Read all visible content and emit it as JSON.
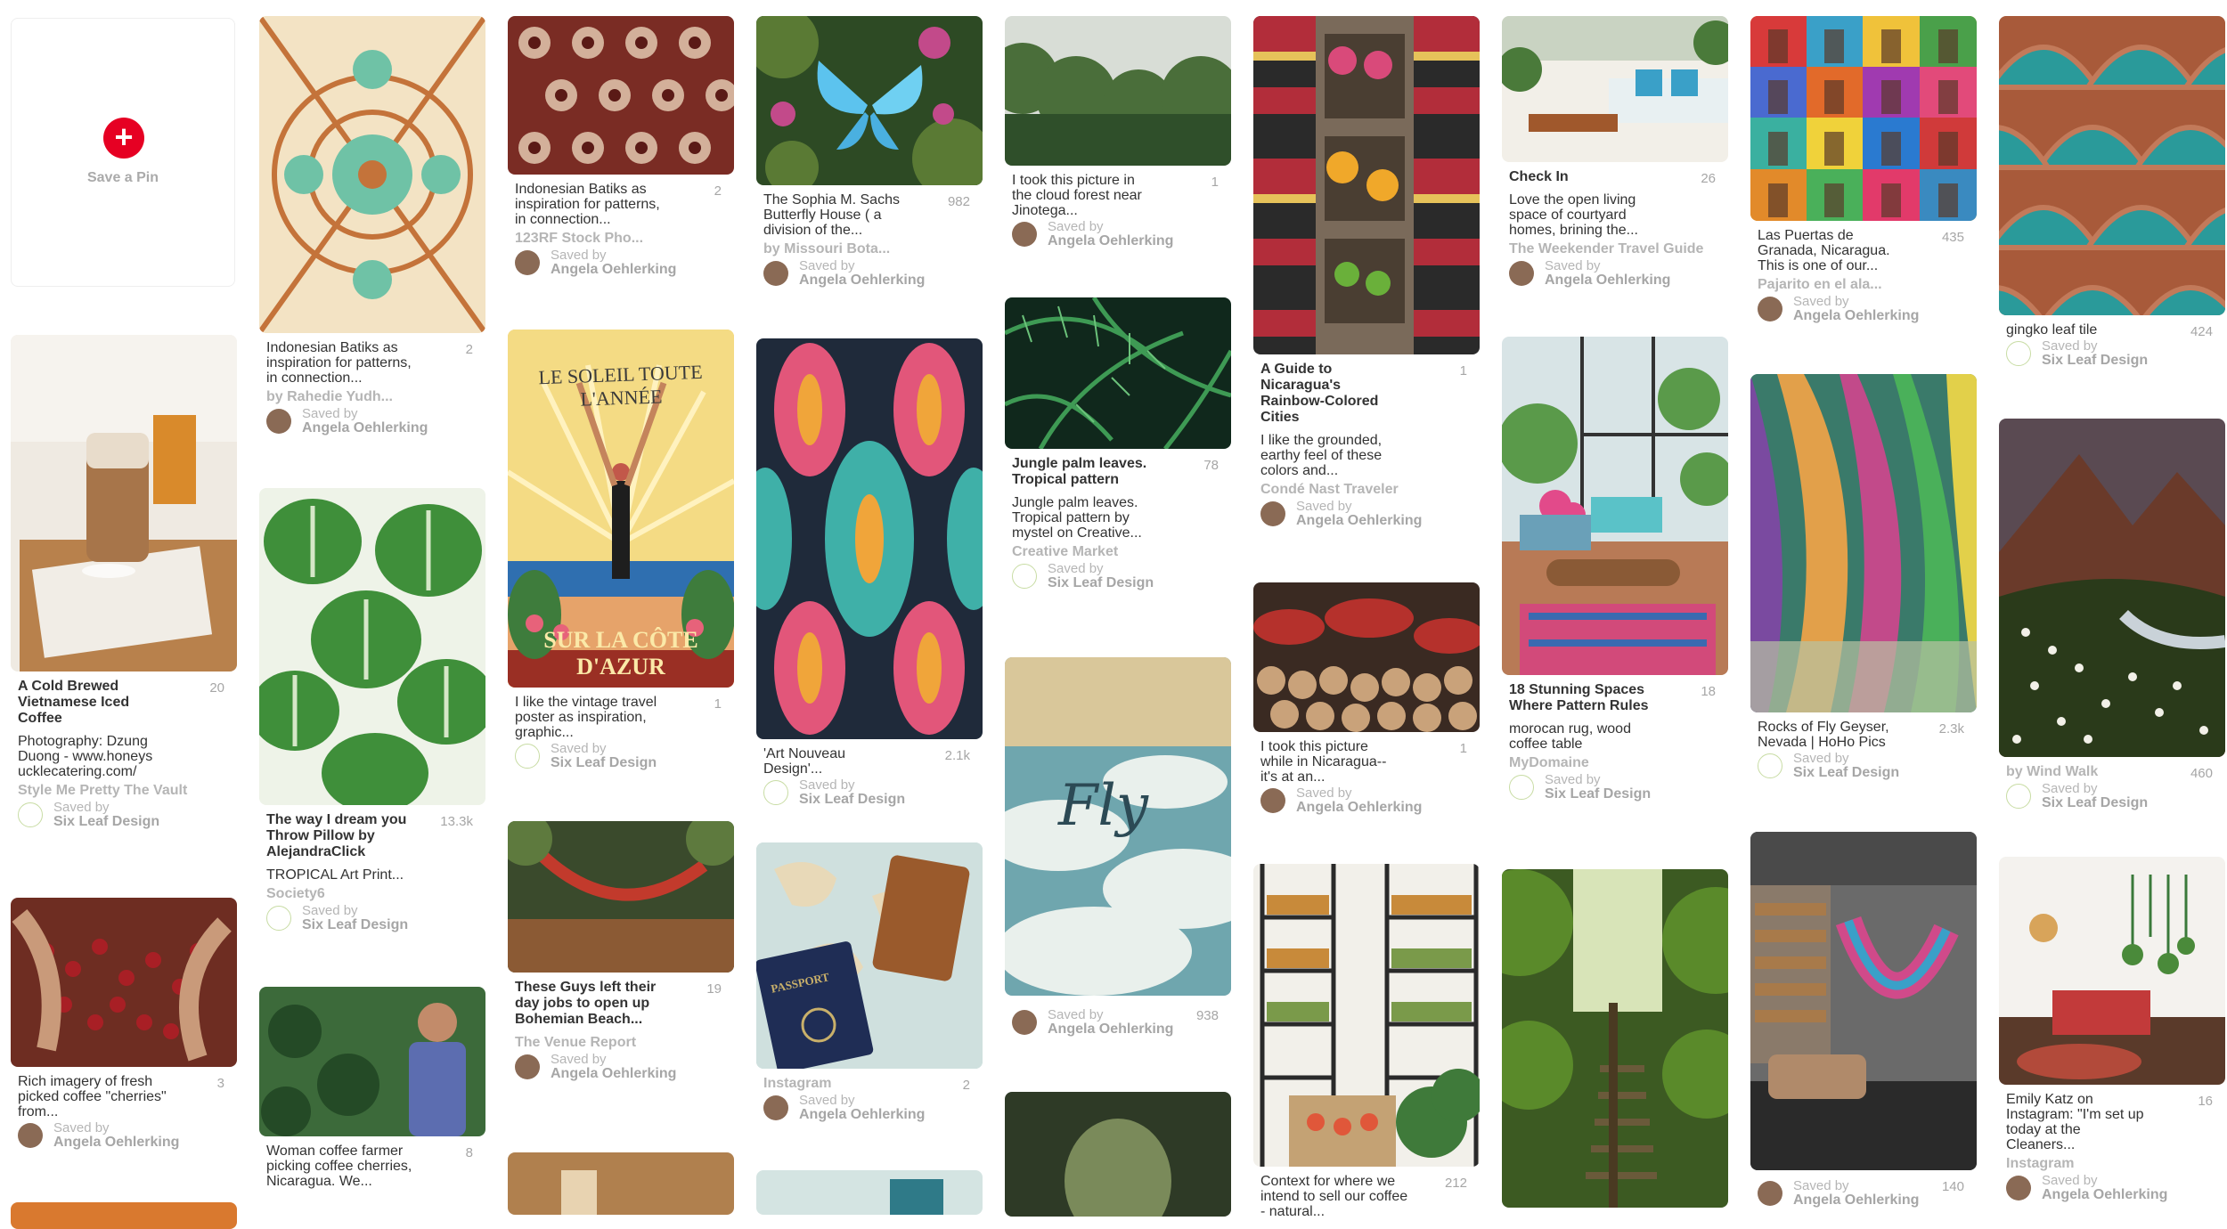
{
  "save_pin": {
    "label": "Save a Pin",
    "plus": "+"
  },
  "saved_by_label": "Saved by",
  "icons": {
    "add": "plus-icon",
    "repin": "pin-icon",
    "leaf": "leaf-avatar-icon"
  },
  "colors": {
    "accent": "#e60023",
    "muted": "#b5b5b5"
  },
  "pins": {
    "c1p1": {
      "title": "A Cold Brewed Vietnamese Iced Coffee",
      "repins": "20",
      "desc": "Photography: Dzung Duong - www.honeysucklecatering.com/",
      "source": "Style Me Pretty The Vault",
      "saved_by": "Six Leaf Design"
    },
    "c1p2": {
      "desc": "Rich imagery of fresh picked coffee \"cherries\" from...",
      "repins": "3",
      "saved_by": "Angela Oehlerking"
    },
    "c2p1": {
      "desc": "Indonesian Batiks as inspiration for patterns, in connection...",
      "repins": "2",
      "source": "by Rahedie Yudh...",
      "saved_by": "Angela Oehlerking"
    },
    "c2p2": {
      "title": "The way I dream you Throw Pillow by AlejandraClick",
      "repins": "13.3k",
      "desc": "TROPICAL Art Print...",
      "source": "Society6",
      "saved_by": "Six Leaf Design"
    },
    "c2p3": {
      "desc": "Woman coffee farmer picking coffee cherries, Nicaragua. We...",
      "repins": "8"
    },
    "c3p1": {
      "desc": "Indonesian Batiks as inspiration for patterns, in connection...",
      "repins": "2",
      "source": "123RF Stock Pho...",
      "saved_by": "Angela Oehlerking"
    },
    "c3p2": {
      "desc": "I like the vintage travel poster as inspiration, graphic...",
      "repins": "1",
      "saved_by": "Six Leaf Design",
      "poster_top": "LE SOLEIL TOUTE L'ANNÉE",
      "poster_bottom": "SUR LA CÔTE D'AZUR"
    },
    "c3p3": {
      "title": "These Guys left their day jobs to open up Bohemian Beach...",
      "repins": "19",
      "source": "The Venue Report",
      "saved_by": "Angela Oehlerking"
    },
    "c4p1": {
      "desc": "The Sophia M. Sachs Butterfly House ( a division of the...",
      "repins": "982",
      "source": "by Missouri Bota...",
      "saved_by": "Angela Oehlerking"
    },
    "c4p2": {
      "desc": "'Art Nouveau Design'...",
      "repins": "2.1k",
      "saved_by": "Six Leaf Design"
    },
    "c4p3": {
      "source": "Instagram",
      "repins": "2",
      "saved_by": "Angela Oehlerking",
      "passport": "PASSPORT"
    },
    "c5p1": {
      "desc": "I took this picture in the cloud forest near Jinotega...",
      "repins": "1",
      "saved_by": "Angela Oehlerking"
    },
    "c5p2": {
      "title": "Jungle palm leaves. Tropical pattern",
      "repins": "78",
      "desc": "Jungle palm leaves. Tropical pattern by mystel on Creative...",
      "source": "Creative Market",
      "saved_by": "Six Leaf Design"
    },
    "c5p3": {
      "repins": "938",
      "saved_by": "Angela Oehlerking",
      "script": "Fly"
    },
    "c6p1": {
      "title": "A Guide to Nicaragua's Rainbow-Colored Cities",
      "repins": "1",
      "desc": "I like the grounded, earthy feel of these colors and...",
      "source": "Condé Nast Traveler",
      "saved_by": "Angela Oehlerking"
    },
    "c6p2": {
      "desc": "I took this picture while in Nicaragua--it's at an...",
      "repins": "1",
      "saved_by": "Angela Oehlerking"
    },
    "c6p3": {
      "desc": "Context for where we intend to sell our coffee - natural...",
      "repins": "212"
    },
    "c7p1": {
      "title": "Check In",
      "repins": "26",
      "desc": "Love the open living space of courtyard homes, brining the...",
      "source": "The Weekender Travel Guide",
      "saved_by": "Angela Oehlerking"
    },
    "c7p2": {
      "title": "18 Stunning Spaces Where Pattern Rules",
      "repins": "18",
      "desc": "morocan rug, wood coffee table",
      "source": "MyDomaine",
      "saved_by": "Six Leaf Design"
    },
    "c8p1": {
      "desc": "Las Puertas de Granada, Nicaragua. This is one of our...",
      "repins": "435",
      "source": "Pajarito en el ala...",
      "saved_by": "Angela Oehlerking"
    },
    "c8p2": {
      "desc": "Rocks of Fly Geyser, Nevada | HoHo Pics",
      "repins": "2.3k",
      "saved_by": "Six Leaf Design"
    },
    "c8p3": {
      "repins": "140",
      "saved_by": "Angela Oehlerking"
    },
    "c9p1": {
      "desc": "gingko leaf tile",
      "repins": "424",
      "saved_by": "Six Leaf Design"
    },
    "c9p2": {
      "source": "by Wind Walk",
      "repins": "460",
      "saved_by": "Six Leaf Design"
    },
    "c9p3": {
      "desc": "Emily Katz on Instagram: \"I'm set up today at the Cleaners...",
      "repins": "16",
      "source": "Instagram",
      "saved_by": "Angela Oehlerking"
    }
  }
}
